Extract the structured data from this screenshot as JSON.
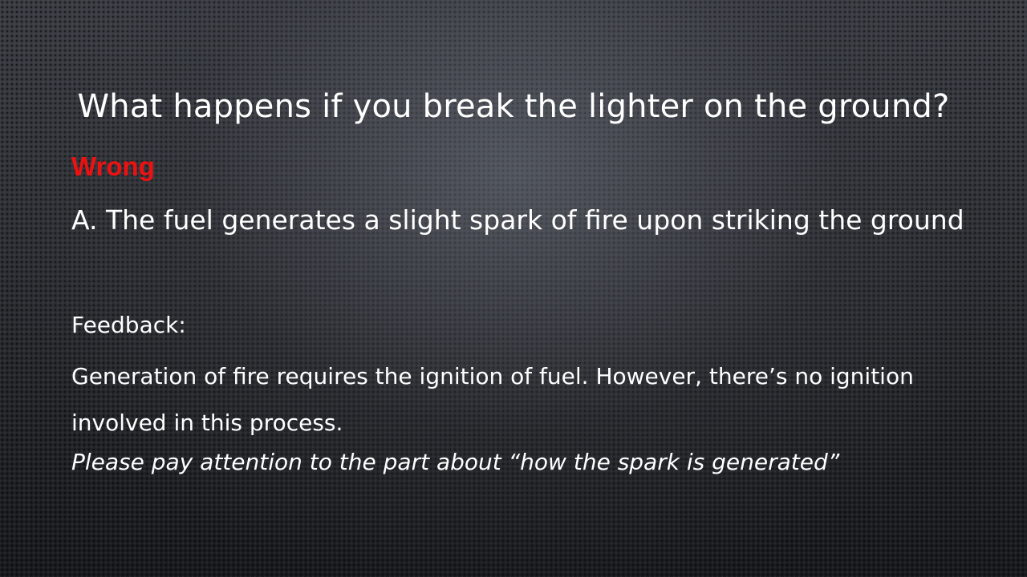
{
  "slide": {
    "title": "What happens if you break the lighter on the ground?",
    "verdict": "Wrong",
    "answer": "A. The fuel generates a slight spark of fire upon striking the ground",
    "feedback_label": "Feedback:",
    "feedback_text": "Generation of fire requires the ignition of fuel. However, there’s no ignition involved in this process.",
    "hint": "Please pay attention to  the part about “how the spark is generated”"
  },
  "colors": {
    "verdict": "#ee1111",
    "text": "#ffffff",
    "background": "#2c2f34"
  }
}
